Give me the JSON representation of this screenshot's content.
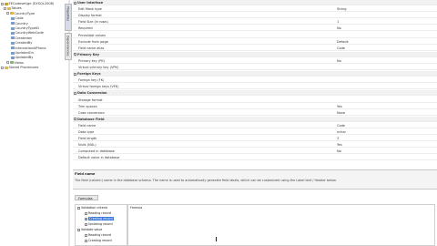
{
  "tree": {
    "items": [
      {
        "label": "EECodeset\\ge (EXSQL2008)",
        "icon": "db"
      },
      {
        "label": "Tables",
        "icon": "folder"
      },
      {
        "label": "CountryType",
        "icon": "tbl"
      },
      {
        "label": "Code",
        "icon": "fld"
      },
      {
        "label": "Country",
        "icon": "fld"
      },
      {
        "label": "CountryTypeID",
        "icon": "fld"
      },
      {
        "label": "CountryWebCode",
        "icon": "fld"
      },
      {
        "label": "Createdon",
        "icon": "fld"
      },
      {
        "label": "CreatedBy",
        "icon": "fld"
      },
      {
        "label": "InternationalPhone",
        "icon": "fld"
      },
      {
        "label": "UpdatedOn",
        "icon": "fld"
      },
      {
        "label": "UpdatedBy",
        "icon": "fld"
      },
      {
        "label": "Views",
        "icon": "view"
      },
      {
        "label": "Stored Procedures",
        "icon": "folder"
      }
    ]
  },
  "vtabs": [
    "Properties",
    "Dependencies"
  ],
  "props": {
    "rows": [
      {
        "cat": true,
        "name": "User Interface"
      },
      {
        "name": "Edit Mask type",
        "value": "String"
      },
      {
        "name": "Display format",
        "value": ""
      },
      {
        "name": "Field Size (in rows)",
        "value": "1"
      },
      {
        "name": "Required",
        "value": "No"
      },
      {
        "name": "Prevalidat values",
        "value": ""
      },
      {
        "name": "Exclude from page",
        "value": "Default"
      },
      {
        "name": "Field name alias",
        "value": "Code"
      },
      {
        "cat": true,
        "name": "Primary Key"
      },
      {
        "name": "Primary key (PK)",
        "value": "No"
      },
      {
        "name": "Virtual primary key (VPK)",
        "value": ""
      },
      {
        "cat": true,
        "name": "Foreign Keys"
      },
      {
        "name": "Foreign key (FK)",
        "value": ""
      },
      {
        "name": "Virtual foreign keys (VFK)",
        "value": ""
      },
      {
        "cat": true,
        "name": "Data Conversion"
      },
      {
        "name": "Storage format",
        "value": ""
      },
      {
        "name": "Trim spaces",
        "value": "Yes"
      },
      {
        "name": "Case conversion",
        "value": "None"
      },
      {
        "cat": true,
        "name": "Database Field"
      },
      {
        "name": "Field name",
        "value": "Code"
      },
      {
        "name": "Data type",
        "value": "nchar"
      },
      {
        "name": "Field length",
        "value": "3"
      },
      {
        "name": "Nulls (NUL)",
        "value": "Yes"
      },
      {
        "name": "Computed in database",
        "value": "No"
      },
      {
        "name": "Default value in database",
        "value": ""
      }
    ]
  },
  "description": {
    "title": "Field name",
    "text": "The field (column) name in the database schema. The name is used to automatically generate field labels, which can be customized using the Label text / Header below."
  },
  "bottom": {
    "tab": "Formulas",
    "formula_header": "Formula",
    "options": [
      {
        "label": "Validation criteria",
        "level": 0
      },
      {
        "label": "Reading record",
        "level": 1
      },
      {
        "label": "Creating record",
        "level": 1,
        "selected": true,
        "checked": true
      },
      {
        "label": "Updating record",
        "level": 1
      },
      {
        "label": "Validate value",
        "level": 0
      },
      {
        "label": "Reading record",
        "level": 1
      },
      {
        "label": "Creating record",
        "level": 1
      }
    ]
  }
}
